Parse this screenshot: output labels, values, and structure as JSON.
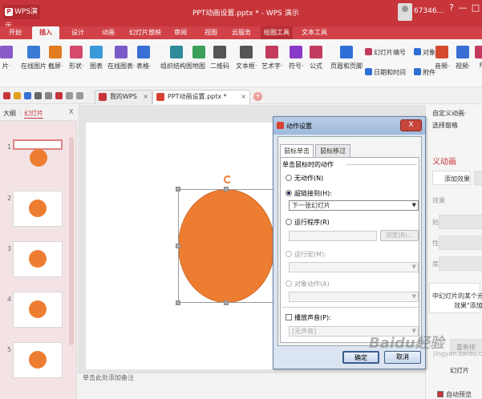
{
  "app": {
    "name": "WPS演示",
    "logo_letter": "P",
    "window_title": "PPT动画设置.pptx * - WPS 演示",
    "user": "67346..."
  },
  "window_buttons": [
    "?",
    "—",
    "□"
  ],
  "menu_tabs": [
    "开始",
    "插入",
    "设计",
    "动画",
    "幻灯片放映",
    "审阅",
    "视图",
    "云服务",
    "绘图工具",
    "文本工具"
  ],
  "active_tab": "插入",
  "ribbon": {
    "buttons": [
      {
        "label": "片·",
        "icon": "picture-icon",
        "color": "#8a5cc9"
      },
      {
        "label": "在线图片",
        "icon": "online-picture-icon",
        "color": "#3a7bd5"
      },
      {
        "label": "截屏·",
        "icon": "screenshot-icon",
        "color": "#e07b20"
      },
      {
        "label": "形状·",
        "icon": "shapes-icon",
        "color": "#d64a6e"
      },
      {
        "label": "图表",
        "icon": "chart-icon",
        "color": "#3a9ad9"
      },
      {
        "label": "在线图表·",
        "icon": "online-chart-icon",
        "color": "#7a5cc9"
      },
      {
        "label": "表格·",
        "icon": "table-icon",
        "color": "#3a6fd5"
      },
      {
        "label": "组织结构图",
        "icon": "org-chart-icon",
        "color": "#2f8a9a"
      },
      {
        "label": "地图",
        "icon": "map-icon",
        "color": "#3aa05a"
      },
      {
        "label": "二维码",
        "icon": "qrcode-icon",
        "color": "#555555"
      },
      {
        "label": "文本框·",
        "icon": "textbox-icon",
        "color": "#555555"
      },
      {
        "label": "艺术字·",
        "icon": "wordart-icon",
        "color": "#c43a5e"
      },
      {
        "label": "符号·",
        "icon": "symbol-icon",
        "color": "#8a3ac9"
      },
      {
        "label": "公式",
        "icon": "formula-icon",
        "color": "#c43a5e"
      },
      {
        "label": "页眉和页脚",
        "icon": "header-footer-icon",
        "color": "#2f6fd5"
      },
      {
        "label": "音频·",
        "icon": "audio-icon",
        "color": "#d54a2f"
      },
      {
        "label": "视频·",
        "icon": "video-icon",
        "color": "#3a6fd5"
      },
      {
        "label": "F",
        "icon": "flash-icon",
        "color": "#c43a5e"
      }
    ],
    "small": [
      {
        "label": "幻灯片编号",
        "icon": "slide-number-icon",
        "color": "#c43a5e"
      },
      {
        "label": "对象",
        "icon": "object-icon",
        "color": "#2f6fd5"
      },
      {
        "label": "日期和时间",
        "icon": "datetime-icon",
        "color": "#2f6fd5"
      },
      {
        "label": "附件",
        "icon": "attachment-icon",
        "color": "#2f6fd5"
      }
    ]
  },
  "doc_tabs": [
    {
      "label": "我的WPS",
      "active": false
    },
    {
      "label": "PPT动画设置.pptx *",
      "active": true
    }
  ],
  "left_panel": {
    "tab_outline": "大纲",
    "tab_slides": "幻灯片",
    "close": "X",
    "slide_numbers": [
      "1",
      "2",
      "3",
      "4",
      "5"
    ]
  },
  "notes_placeholder": "单击此处添加备注",
  "right_panel": {
    "items": [
      "自定义动画·",
      "选择窗格",
      "义动画",
      "添加效果",
      "效果",
      "始:",
      "性:",
      "度:",
      "中幻灯片的某个元素",
      "效果\"添加",
      "重新排",
      "幻灯片",
      "自动预览"
    ]
  },
  "dialog": {
    "title": "动作设置",
    "close": "X",
    "tabs": [
      "鼠标单击",
      "鼠标移过"
    ],
    "group_label": "单击鼠标时的动作",
    "options": [
      {
        "label": "无动作(N)",
        "selected": false,
        "enabled": true
      },
      {
        "label": "超链接到(H):",
        "selected": true,
        "enabled": true
      },
      {
        "label": "运行程序(R)",
        "selected": false,
        "enabled": true
      },
      {
        "label": "运行宏(M):",
        "selected": false,
        "enabled": false
      },
      {
        "label": "对象动作(A)",
        "selected": false,
        "enabled": false
      }
    ],
    "hyperlink_value": "下一张幻灯片",
    "browse": "浏览(B)...",
    "play_sound": "播放声音(P):",
    "sound_value": "[无声音]",
    "ok": "确定",
    "cancel": "取消"
  },
  "colors": {
    "brand": "#c7343a",
    "shape": "#ed7d31"
  },
  "watermark": {
    "text": "Baidu经验",
    "url": "jingyan.baidu.com"
  }
}
